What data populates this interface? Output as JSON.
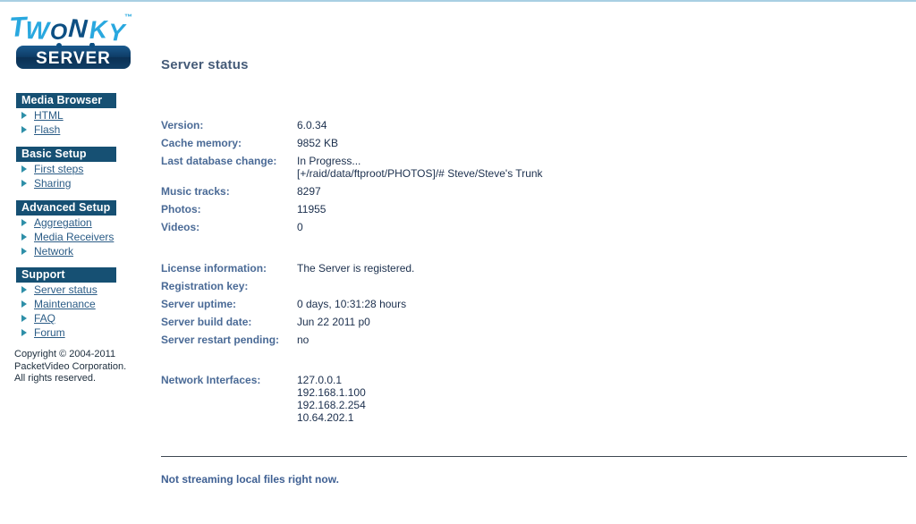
{
  "brand": {
    "word_mark": "TWONKY",
    "trademark": "™",
    "badge": "SERVER"
  },
  "sidebar": {
    "groups": [
      {
        "title": "Media Browser",
        "items": [
          {
            "label": "HTML"
          },
          {
            "label": "Flash"
          }
        ]
      },
      {
        "title": "Basic Setup",
        "items": [
          {
            "label": "First steps"
          },
          {
            "label": "Sharing"
          }
        ]
      },
      {
        "title": "Advanced Setup",
        "items": [
          {
            "label": "Aggregation"
          },
          {
            "label": "Media Receivers"
          },
          {
            "label": "Network"
          }
        ]
      },
      {
        "title": "Support",
        "items": [
          {
            "label": "Server status"
          },
          {
            "label": "Maintenance"
          },
          {
            "label": "FAQ"
          },
          {
            "label": "Forum"
          }
        ]
      }
    ],
    "copyright": {
      "line1": "Copyright © 2004-2011",
      "line2": "PacketVideo Corporation.",
      "line3": "All rights reserved."
    }
  },
  "main": {
    "page_title": "Server status",
    "version_block": {
      "version_label": "Version:",
      "version_value": "6.0.34",
      "cache_label": "Cache memory:",
      "cache_value": "9852 KB",
      "dbchange_label": "Last database change:",
      "dbchange_value": "In Progress...",
      "dbchange_detail": "[+/raid/data/ftproot/PHOTOS]/# Steve/Steve's Trunk",
      "music_label": "Music tracks:",
      "music_value": "8297",
      "photos_label": "Photos:",
      "photos_value": "11955",
      "videos_label": "Videos:",
      "videos_value": "0"
    },
    "license_block": {
      "license_label": "License information:",
      "license_value": "The Server is registered.",
      "regkey_label": "Registration key:",
      "regkey_value": "",
      "uptime_label": "Server uptime:",
      "uptime_value": "0 days, 10:31:28 hours",
      "build_label": "Server build date:",
      "build_value": "Jun 22 2011 p0",
      "restart_label": "Server restart pending:",
      "restart_value": "no"
    },
    "network_block": {
      "network_label": "Network Interfaces:",
      "interfaces": [
        "127.0.0.1",
        "192.168.1.100",
        "192.168.2.254",
        "10.64.202.1"
      ]
    },
    "footer_status": "Not streaming local files right now."
  },
  "colors": {
    "nav_header_bg": "#165073",
    "nav_link": "#2b5c86",
    "nav_arrow": "#2e8fa8",
    "label": "#4a6a96",
    "value": "#1b2f4d",
    "title": "#455b78",
    "brand_light": "#29a8df",
    "brand_dark": "#0d4f83",
    "top_border": "#a9cfe3"
  }
}
